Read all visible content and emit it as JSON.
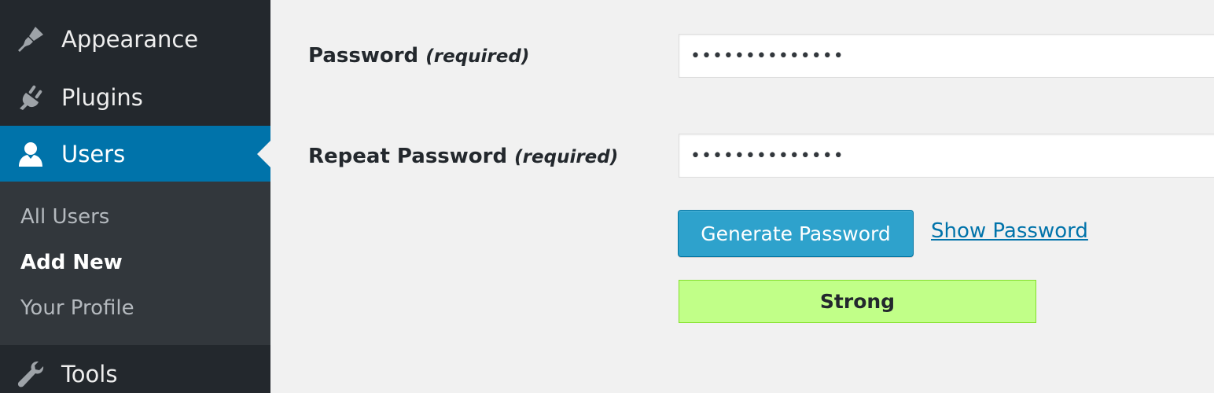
{
  "sidebar": {
    "items": [
      {
        "label": "Appearance",
        "icon": "paintbrush-icon"
      },
      {
        "label": "Plugins",
        "icon": "plugin-icon"
      },
      {
        "label": "Users",
        "icon": "user-icon",
        "active": true
      },
      {
        "label": "Tools",
        "icon": "wrench-icon"
      }
    ],
    "submenu": [
      "All Users",
      "Add New",
      "Your Profile"
    ],
    "active_submenu": "Add New"
  },
  "form": {
    "password_label": "Password",
    "password_required": "(required)",
    "password_value": "••••••••••••••",
    "repeat_label": "Repeat Password",
    "repeat_required": "(required)",
    "repeat_value": "••••••••••••••",
    "generate_button": "Generate Password",
    "show_link": "Show Password",
    "strength": "Strong"
  },
  "colors": {
    "sidebar_bg": "#23282d",
    "submenu_bg": "#32373c",
    "active_blue": "#0073aa",
    "button_blue": "#2ea2cc",
    "strength_green": "#c1ff88"
  }
}
